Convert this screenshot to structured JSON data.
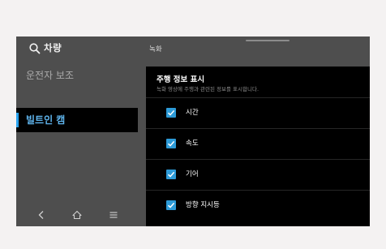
{
  "header": {
    "search_title": "차량",
    "tab_title": "녹화",
    "search_icon": "search-icon"
  },
  "sidebar": {
    "items": [
      {
        "label": "운전자 보조",
        "active": false
      },
      {
        "label": "빌트인 캠",
        "active": true
      }
    ]
  },
  "bottom_nav": {
    "icons": [
      "back-icon",
      "home-icon",
      "menu-icon"
    ]
  },
  "panel": {
    "title": "주행 정보 표시",
    "description": "녹화 영상에 주행과 관련된 정보를 표시합니다.",
    "options": [
      {
        "label": "시간",
        "checked": true
      },
      {
        "label": "속도",
        "checked": true
      },
      {
        "label": "기어",
        "checked": true
      },
      {
        "label": "방향 지시등",
        "checked": true
      }
    ]
  },
  "colors": {
    "accent": "#2d9bd8",
    "active_text": "#5fb5ee",
    "screen_bg": "#4e4e4e",
    "panel_bg": "#000000"
  }
}
